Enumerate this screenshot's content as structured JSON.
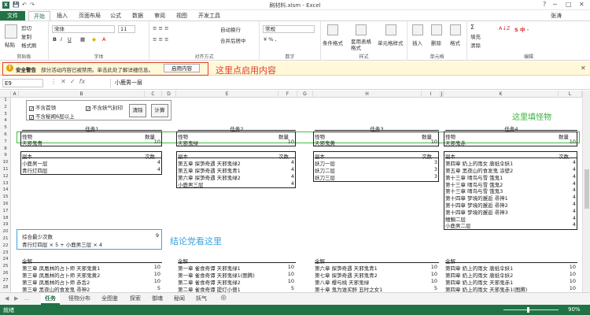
{
  "window": {
    "title": "刷材料.xlsm - Excel",
    "user": "张涛",
    "min": "─",
    "max": "□",
    "close": "✕",
    "help": "?"
  },
  "ribbon_tabs": [
    "文件",
    "开始",
    "插入",
    "页面布局",
    "公式",
    "数据",
    "审阅",
    "视图",
    "开发工具"
  ],
  "ribbon": {
    "paste": "粘贴",
    "cut": "剪切",
    "copy": "复制",
    "format_painter": "格式刷",
    "clipboard_group": "剪贴板",
    "font_name": "宋体",
    "font_size": "11",
    "font_group": "字体",
    "wrap": "自动换行",
    "merge": "合并后居中",
    "align_group": "对齐方式",
    "num_format": "常规",
    "number_group": "数字",
    "cond_fmt": "条件格式",
    "table_fmt": "套用表格格式",
    "cell_style": "单元格样式",
    "style_group": "样式",
    "insert": "插入",
    "delete": "删除",
    "format": "格式",
    "cells_group": "单元格",
    "autosum": "Σ",
    "fill": "填充",
    "clear": "清除",
    "editing_group": "编辑"
  },
  "security": {
    "label": "安全警告",
    "message": "部分活动内容已被禁用。单击此处了解详细信息。",
    "button": "启用内容",
    "annotation": "这里点启用内容"
  },
  "formula_bar": {
    "name_box": "E9",
    "fx": "fx",
    "value": "小鹿男一层"
  },
  "columns": [
    "A",
    "B",
    "C",
    "D",
    "E",
    "F",
    "G",
    "H",
    "I",
    "J",
    "K",
    "L"
  ],
  "rows": [
    "1",
    "2",
    "3",
    "4",
    "5",
    "6",
    "7",
    "8",
    "9",
    "10",
    "11",
    "12",
    "13",
    "14",
    "15",
    "16",
    "17",
    "18",
    "19",
    "20",
    "21",
    "22",
    "23",
    "24",
    "25",
    "26",
    "27",
    "28"
  ],
  "controls": {
    "cb1": "不含首领",
    "cb2": "不含妖气封印",
    "cb3": "不含秘闻6层以上",
    "btn_clear": "清除",
    "btn_calc": "计算"
  },
  "tasks": [
    {
      "title": "任务1",
      "monster_h": "怪物",
      "count_h": "数量",
      "monster": "天邪鬼青",
      "count": "10",
      "copy_h": "副本",
      "times_h": "次数",
      "copies": [
        [
          "小鹿男一层",
          "4"
        ],
        [
          "青行灯四层",
          "4"
        ]
      ]
    },
    {
      "title": "任务2",
      "monster_h": "怪物",
      "count_h": "数量",
      "monster": "天邪鬼绿",
      "count": "10",
      "copy_h": "副本",
      "times_h": "次数",
      "copies": [
        [
          "第五章 探笋奇遇 天邪鬼绿2",
          "4"
        ],
        [
          "第五章 探笋奇遇 天邪鬼青1",
          "4"
        ],
        [
          "第六章 探笋奇遇 天邪鬼绿2",
          "4"
        ],
        [
          "小鹿男三层",
          "4"
        ]
      ]
    },
    {
      "title": "任务3",
      "monster_h": "怪物",
      "count_h": "数量",
      "monster": "天邪鬼黄",
      "count": "10",
      "copy_h": "副本",
      "times_h": "次数",
      "copies": [
        [
          "妖刀一层",
          "3"
        ],
        [
          "妖刀二层",
          "3"
        ],
        [
          "妖刀三层",
          "3"
        ]
      ]
    },
    {
      "title": "任务4",
      "monster_h": "怪物",
      "count_h": "数量",
      "monster": "天邪鬼赤",
      "count": "10",
      "copy_h": "副本",
      "times_h": "次数",
      "copies": [
        [
          "第四章 奶上的雨女 唐纸伞妖1",
          "4"
        ],
        [
          "第五章 黑夜山的食发鬼 涂壁2",
          "4"
        ],
        [
          "第十三章 晴鸟与雪 饿鬼1",
          "4"
        ],
        [
          "第十三章 晴鸟与雪 饿鬼2",
          "4"
        ],
        [
          "第十三章 晴鸟与雪 饿鬼3",
          "4"
        ],
        [
          "第十四章 梦境的邂逅 帚神1",
          "4"
        ],
        [
          "第十四章 梦境的邂逅 帚神2",
          "4"
        ],
        [
          "第十四章 梦境的邂逅 帚神3",
          "4"
        ],
        [
          "鳍鲷二层",
          "4"
        ],
        [
          "小鹿男二层",
          "4"
        ]
      ]
    }
  ],
  "green_annotation": "这里填怪物",
  "summary": {
    "label": "综合最少次数",
    "value": "9",
    "detail": "青行灯四层 × 5 + 小鹿男三层 × 4",
    "annotation": "结论党看这里"
  },
  "lower": [
    {
      "h": "全解",
      "rows": [
        [
          "第三章 凤凰林的占卜师 天邪鬼黄1",
          "10"
        ],
        [
          "第三章 凤凰林的占卜师 天邪鬼黄2",
          "10"
        ],
        [
          "第三章 凤凰林的占卜师 赤舌2",
          "10"
        ],
        [
          "第三章 黑夜山的食发鬼 帚神2",
          "5"
        ],
        [
          "第三章 黑夜山的食发鬼 帚神1",
          "5"
        ]
      ]
    },
    {
      "h": "全解",
      "rows": [
        [
          "第一章 雀食奇谭 天邪鬼绿1",
          "10"
        ],
        [
          "第一章 雀食奇谭 天邪鬼绿1(图腾)",
          "10"
        ],
        [
          "第二章 雀食奇谭 天邪鬼绿2",
          "10"
        ],
        [
          "第二章 雀食奇谭 提灯小僧1",
          "5"
        ],
        [
          "第三章 雀食奇谭 提灯小僧2",
          "5"
        ]
      ]
    },
    {
      "h": "全解",
      "rows": [
        [
          "第六章 探笋奇遇 天邪鬼青1",
          "10"
        ],
        [
          "第七章 探笋奇遇 天邪鬼青2",
          "10"
        ],
        [
          "第八章 樱与桃 天邪鬼绿",
          "10"
        ],
        [
          "第十章 鬼为谁买醉 丑时之女1",
          "5"
        ],
        [
          "第十章 鬼为谁买醉 丑时之女2",
          "5"
        ]
      ]
    },
    {
      "h": "全解",
      "rows": [
        [
          "第四章 奶上的雨女 唐纸伞妖1",
          "10"
        ],
        [
          "第四章 奶上的雨女 唐纸伞妖2",
          "10"
        ],
        [
          "第四章 奶上的雨女 天邪鬼赤1",
          "10"
        ],
        [
          "第四章 奶上的雨女 天邪鬼赤1(图腾)",
          "10"
        ],
        [
          "第五章 黑夜山的食发鬼 天邪鬼赤",
          "5"
        ]
      ]
    }
  ],
  "sheet_tabs": [
    "任务",
    "怪物分布",
    "全图鉴",
    "探索",
    "御魂",
    "秘闻",
    "妖气"
  ],
  "status": {
    "ready": "就绪",
    "zoom": "90%"
  },
  "colors": {
    "excel_green": "#217346",
    "red": "#e03c31",
    "green": "#3fbf3f",
    "blue": "#3da3e0"
  }
}
